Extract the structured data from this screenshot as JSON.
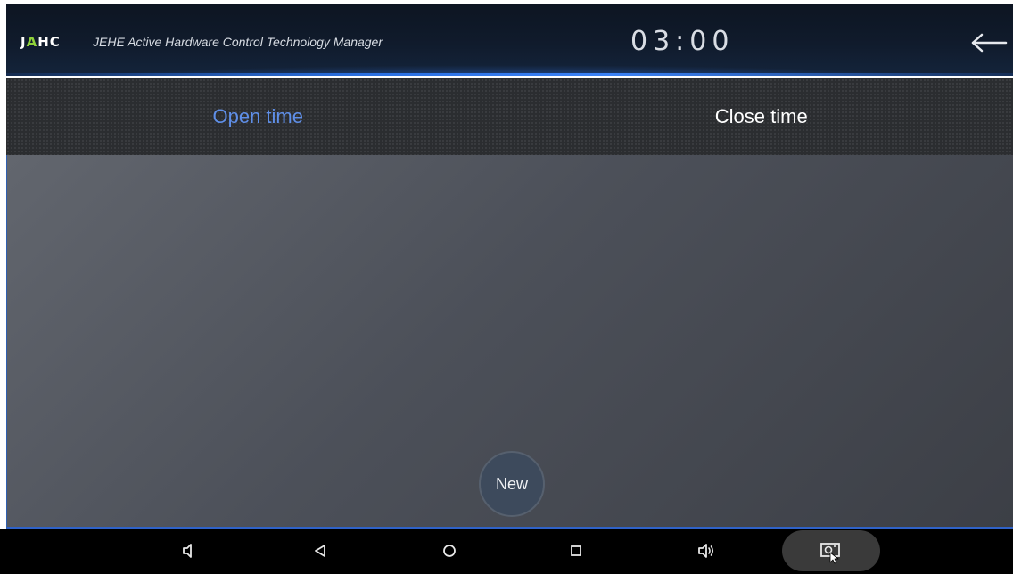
{
  "header": {
    "logo_text_prefix": "J",
    "logo_text_accent": "A",
    "logo_text_suffix": "HC",
    "app_title": "JEHE Active Hardware Control Technology Manager",
    "clock": "03:00",
    "back_icon": "arrow-left-icon"
  },
  "tabs": [
    {
      "label": "Open time",
      "active": true
    },
    {
      "label": "Close time",
      "active": false
    }
  ],
  "content": {
    "new_button_label": "New"
  },
  "navbar": {
    "icons": [
      "volume-down-icon",
      "back-triangle-icon",
      "home-circle-icon",
      "recents-square-icon",
      "volume-up-icon",
      "screenshot-icon"
    ]
  },
  "colors": {
    "accent": "#5f8fe8",
    "logo_accent": "#8fd13a",
    "header_underline": "#3b82f6"
  }
}
